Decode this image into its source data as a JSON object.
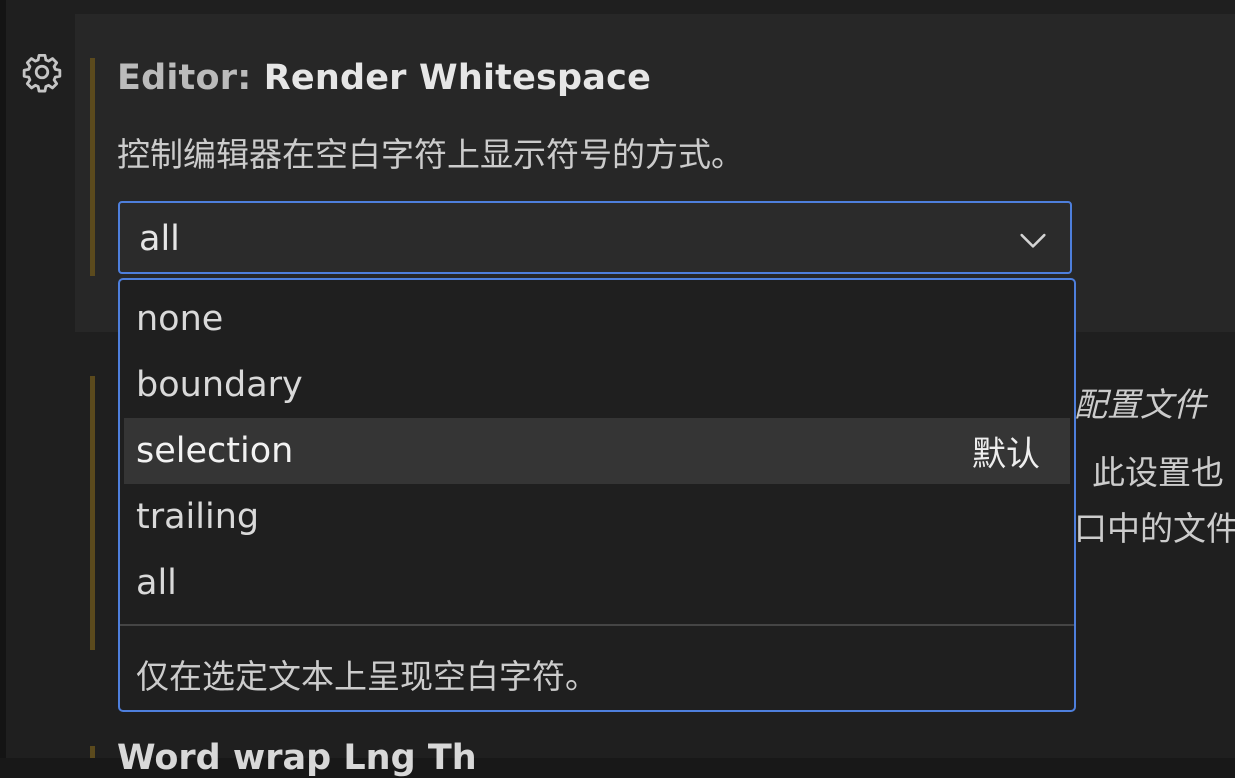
{
  "setting": {
    "category": "Editor: ",
    "name": "Render Whitespace",
    "description": "控制编辑器在空白字符上显示符号的方式。",
    "current_value": "all"
  },
  "dropdown": {
    "options": [
      {
        "label": "none",
        "badge": "",
        "selected": false
      },
      {
        "label": "boundary",
        "badge": "",
        "selected": false
      },
      {
        "label": "selection",
        "badge": "默认",
        "selected": true
      },
      {
        "label": "trailing",
        "badge": "",
        "selected": false
      },
      {
        "label": "all",
        "badge": "",
        "selected": false
      }
    ],
    "option_description": "仅在选定文本上呈现空白字符。"
  },
  "background_setting": {
    "line1": "配置文件",
    "line2": "此设置也",
    "line3": "口中的文件"
  },
  "next_setting": {
    "title": "Word wrap Lng Th"
  },
  "colors": {
    "focus_border": "#4e7fdc",
    "modified_bar": "#5b4a1d",
    "selected_option_bg": "#353535"
  },
  "icons": {
    "manage": "gear-icon",
    "dropdown": "chevron-down-icon"
  }
}
